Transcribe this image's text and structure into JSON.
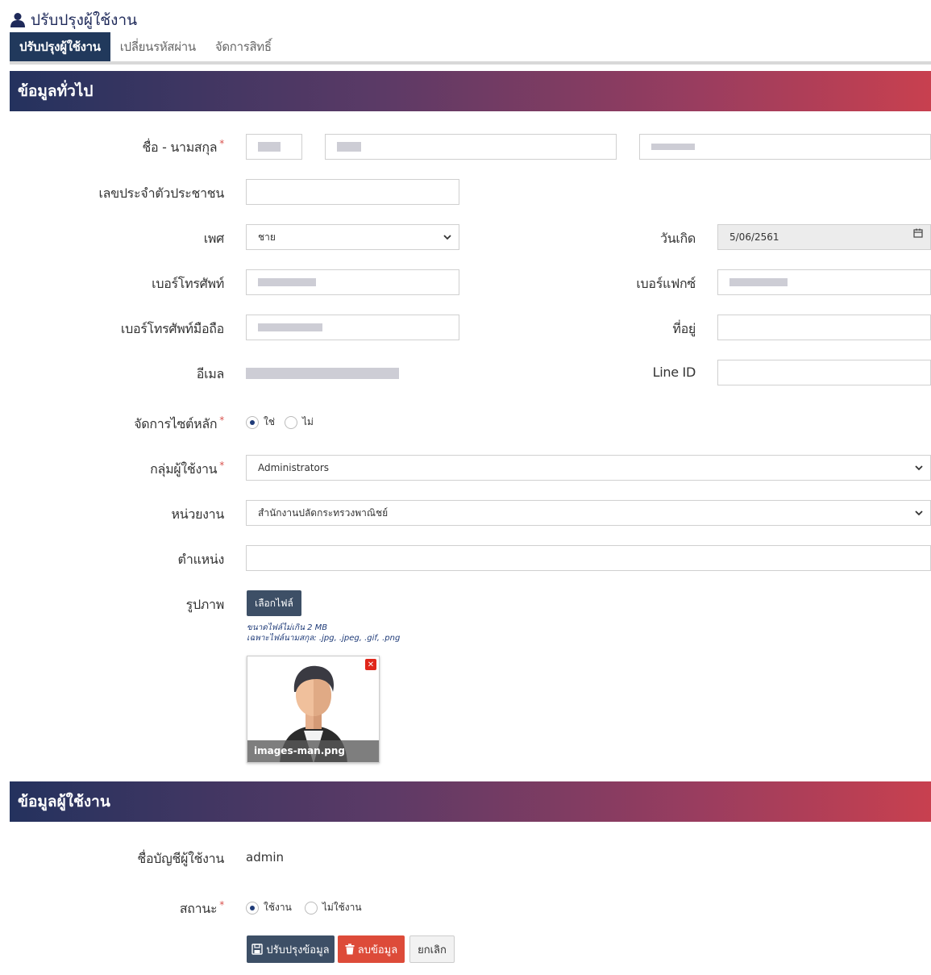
{
  "page": {
    "title": "ปรับปรุงผู้ใช้งาน",
    "title_icon": "user-icon"
  },
  "tabs": [
    {
      "label": "ปรับปรุงผู้ใช้งาน",
      "active": true
    },
    {
      "label": "เปลี่ยนรหัสผ่าน",
      "active": false
    },
    {
      "label": "จัดการสิทธิ์",
      "active": false
    }
  ],
  "sections": {
    "general": "ข้อมูลทั่วไป",
    "user": "ข้อมูลผู้ใช้งาน"
  },
  "colors": {
    "tab_active": "#21395c",
    "gradient_start": "#24325e",
    "gradient_end": "#c8404f",
    "required": "#d9534f",
    "delete": "#dd4b39"
  },
  "form": {
    "name_label": "ชื่อ - นามสกุล",
    "citizen_id_label": "เลขประจำตัวประชาชน",
    "citizen_id_value": "",
    "gender_label": "เพศ",
    "gender_value": "ชาย",
    "birthdate_label": "วันเกิด",
    "birthdate_value": "5/06/2561",
    "phone_label": "เบอร์โทรศัพท์",
    "fax_label": "เบอร์แฟกซ์",
    "mobile_label": "เบอร์โทรศัพท์มือถือ",
    "address_label": "ที่อยู่",
    "address_value": "",
    "email_label": "อีเมล",
    "line_label": "Line ID",
    "line_value": "",
    "main_site_label": "จัดการไซต์หลัก",
    "main_site_yes": "ใช่",
    "main_site_no": "ไม่",
    "main_site_selected": "yes",
    "group_label": "กลุ่มผู้ใช้งาน",
    "group_value": "Administrators",
    "agency_label": "หน่วยงาน",
    "agency_value": "สำนักงานปลัดกระทรวงพาณิชย์",
    "position_label": "ตำแหน่ง",
    "position_value": "",
    "photo_label": "รูปภาพ",
    "choose_file": "เลือกไฟล์",
    "hint_size": "ขนาดไฟล์ไม่เกิน 2 MB",
    "hint_types": "เฉพาะไฟล์นามสกุล: .jpg, .jpeg, .gif, .png",
    "image_name": "images-man.png"
  },
  "account": {
    "username_label": "ชื่อบัญชีผู้ใช้งาน",
    "username_value": "admin",
    "status_label": "สถานะ",
    "status_active": "ใช้งาน",
    "status_inactive": "ไม่ใช้งาน",
    "status_selected": "active"
  },
  "buttons": {
    "update": "ปรับปรุงข้อมูล",
    "delete": "ลบข้อมูล",
    "cancel": "ยกเลิก"
  }
}
